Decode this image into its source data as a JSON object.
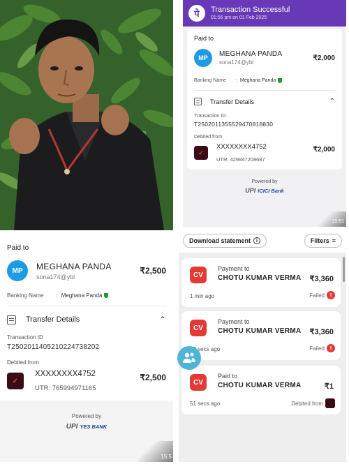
{
  "photo": {
    "subject": "portrait-photo"
  },
  "receipt_top": {
    "header": {
      "title": "Transaction Successful",
      "subtitle": "01:56 pm on 01 Feb 2025",
      "logo": "पे"
    },
    "paid_to_label": "Paid to",
    "payee": {
      "initials": "MP",
      "name": "MEGHANA  PANDA",
      "upi": "sona174@ybl",
      "amount": "₹2,000"
    },
    "banking_name_label": "Banking Name",
    "banking_name_sep": ":",
    "banking_name_value": "Meghana  Panda",
    "transfer_details_label": "Transfer Details",
    "transaction_id_label": "Transaction ID",
    "transaction_id": "T2502011355529470818830",
    "debited_from_label": "Debited from",
    "account": "XXXXXXXX4752",
    "debit_amount": "₹2,000",
    "utr": "UTR: 429847208687",
    "powered_by": "Powered by",
    "upi_logo": "UPI",
    "bank_name": "ICICI Bank",
    "corner_time": "15:51"
  },
  "receipt_bottom": {
    "paid_to_label": "Paid to",
    "payee": {
      "initials": "MP",
      "name": "MEGHANA  PANDA",
      "upi": "sona174@ybl",
      "amount": "₹2,500"
    },
    "banking_name_label": "Banking Name",
    "banking_name_sep": ":",
    "banking_name_value": "Meghana  Panda",
    "transfer_details_label": "Transfer Details",
    "transaction_id_label": "Transaction ID",
    "transaction_id": "T2502011405210224738202",
    "debited_from_label": "Debited from",
    "account": "XXXXXXXX4752",
    "debit_amount": "₹2,500",
    "utr": "UTR: 765994971165",
    "powered_by": "Powered by",
    "upi_logo": "UPI",
    "bank_name": "YES BANK",
    "corner_time": "15:5"
  },
  "history": {
    "download_label": "Download statement",
    "filters_label": "Filters",
    "items": [
      {
        "initials": "CV",
        "type": "Payment to",
        "name": "CHOTU  KUMAR  VERMA",
        "amount": "₹3,360",
        "time": "1 min ago",
        "status": "Failed"
      },
      {
        "initials": "CV",
        "type": "Payment to",
        "name": "CHOTU  KUMAR  VERMA",
        "amount": "₹3,360",
        "time": "57 secs ago",
        "status": "Failed"
      },
      {
        "initials": "CV",
        "type": "Paid to",
        "name": "CHOTU  KUMAR  VERMA",
        "amount": "₹1",
        "time": "51 secs ago",
        "status": "Debited from"
      }
    ]
  },
  "colors": {
    "phonepe_purple": "#6739b7",
    "avatar_blue": "#1e9be5",
    "fail_red": "#e53935",
    "contact_fab": "#4fb5d6"
  },
  "icons": [
    "phonepe-logo-icon",
    "shield-check-icon",
    "document-list-icon",
    "chevron-up-icon",
    "info-circle-icon",
    "filter-lines-icon",
    "failed-exclamation-icon",
    "contacts-icon"
  ]
}
